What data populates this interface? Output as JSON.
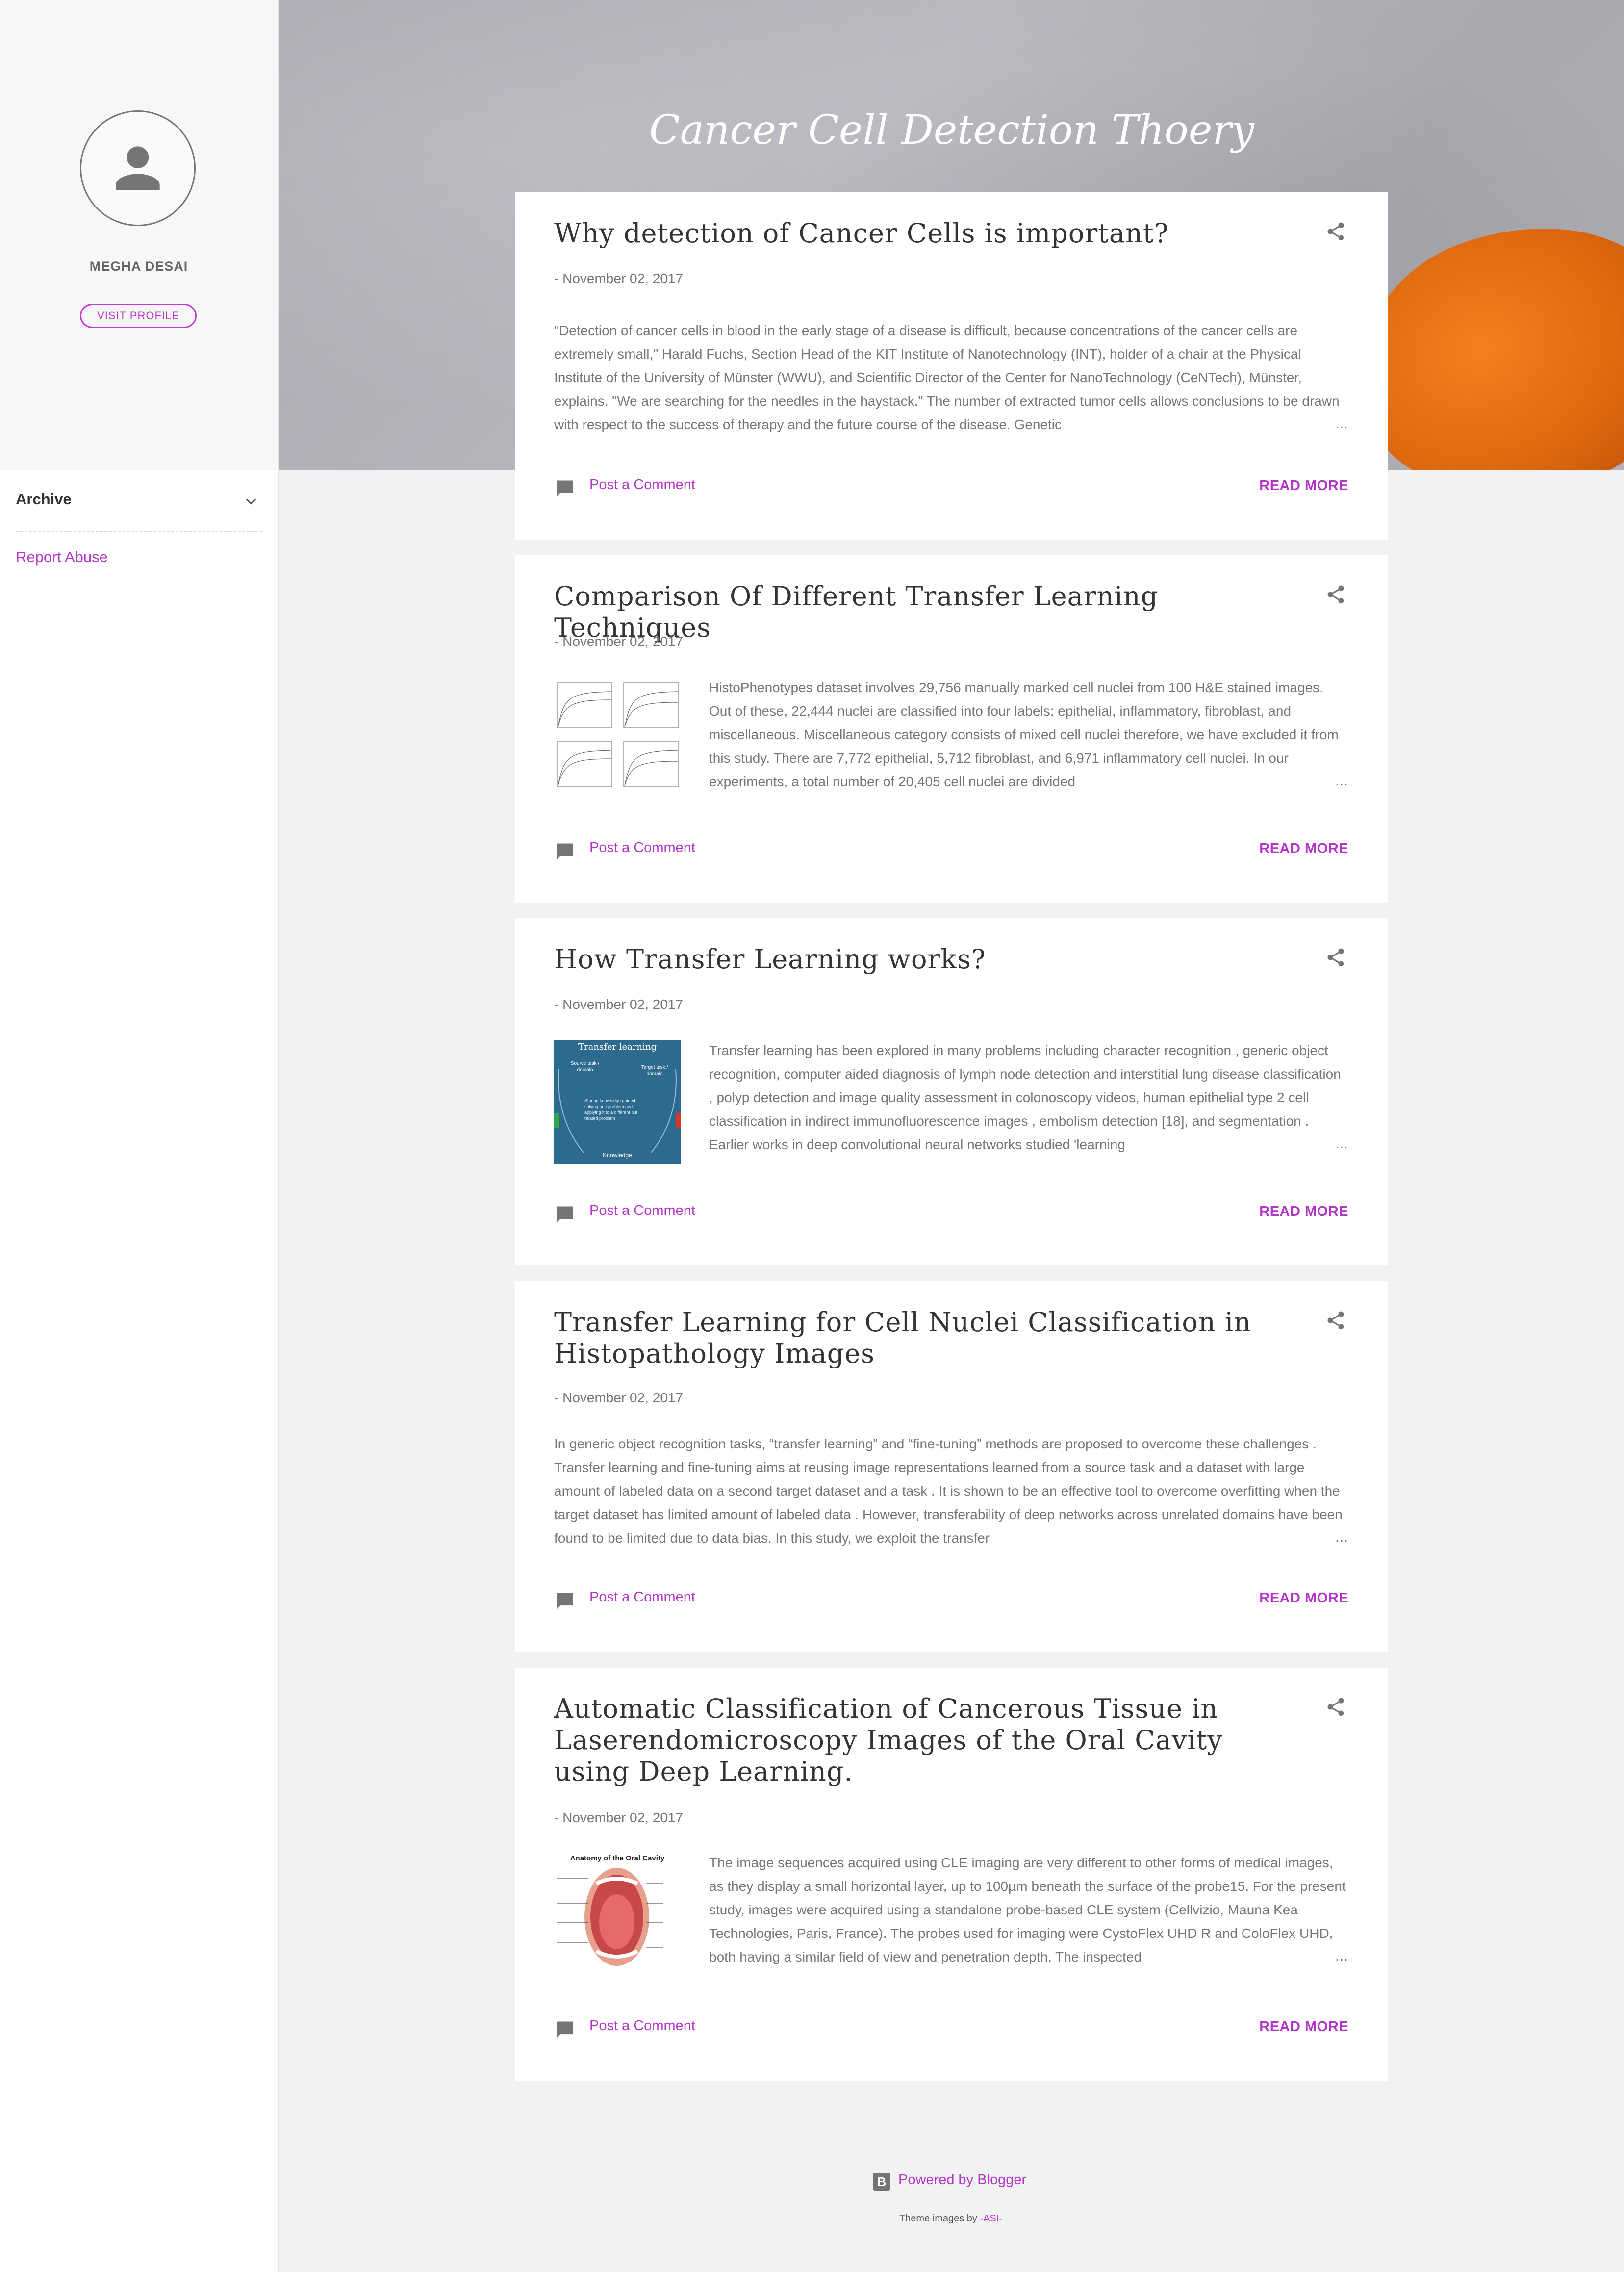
{
  "sidebar": {
    "profile_name": "MEGHA DESAI",
    "visit_profile": "VISIT PROFILE",
    "archive_label": "Archive",
    "report_abuse": "Report Abuse"
  },
  "header": {
    "title": "Cancer Cell Detection Thoery",
    "search_icon": "search-icon"
  },
  "colors": {
    "accent": "#b335c8",
    "text": "#757575",
    "title": "#333333"
  },
  "posts": [
    {
      "title": "Why detection of Cancer Cells is important?",
      "date": "- November 02, 2017",
      "snippet": "\"Detection of cancer cells in blood in the early stage of a disease is difficult, because concentrations of the cancer cells are extremely small,\" Harald Fuchs, Section Head of the KIT Institute of Nanotechnology (INT), holder of a chair at the Physical Institute of the University of Münster (WWU), and Scientific Director of the Center for NanoTechnology (CeNTech), Münster, explains. \"We are searching for the needles in the haystack.\" The number of extracted tumor cells allows conclusions to be drawn with respect to the success of therapy and the future course of the disease. Genetic",
      "ellipsis": "…",
      "comment": "Post a Comment",
      "read_more": "READ MORE"
    },
    {
      "title": "Comparison Of Different Transfer Learning Techniques",
      "date": "- November 02, 2017",
      "snippet": "HistoPhenotypes dataset involves 29,756 manually marked cell nuclei from 100 H&E stained images. Out of these, 22,444 nuclei are classified into four labels: epithelial, inflammatory, fibroblast, and miscellaneous. Miscellaneous category consists of mixed cell nuclei therefore, we have excluded it from this study. There are 7,772 epithelial, 5,712 fibroblast, and 6,971 inflammatory cell nuclei. In our experiments, a total number of 20,405 cell nuclei are divided",
      "ellipsis": "…",
      "comment": "Post a Comment",
      "read_more": "READ MORE"
    },
    {
      "title": "How Transfer Learning works?",
      "date": "- November 02, 2017",
      "snippet": "Transfer learning has been explored in many problems including character recognition , generic object recognition, computer aided diagnosis of lymph node detection and interstitial lung disease classification , polyp detection and image quality assessment in colonoscopy videos, human epithelial type 2 cell classification in indirect immunofluorescence images , embolism detection [18], and segmentation . Earlier works in deep convolutional neural networks studied 'learning",
      "ellipsis": "…",
      "comment": "Post a Comment",
      "read_more": "READ MORE",
      "thumb": {
        "title": "Transfer learning",
        "source": "Source task / domain",
        "target": "Target task / domain",
        "body": "Storing knowledge gained solving one problem and applying it to a different but related problem",
        "knowledge": "Knowledge"
      }
    },
    {
      "title": "Transfer Learning for Cell Nuclei Classification in Histopathology Images",
      "date": "- November 02, 2017",
      "snippet": "In generic object recognition tasks, “transfer learning” and “fine-tuning” methods are proposed to overcome these challenges . Transfer learning and fine-tuning aims at reusing image representations learned from a source task and a dataset with large amount of labeled data on a second target dataset and a task . It is shown to be an effective tool to overcome overfitting when the target dataset has limited amount of labeled data . However, transferability of deep networks across unrelated domains have been found to be limited due to data bias. In this study, we exploit the transfer",
      "ellipsis": "…",
      "comment": "Post a Comment",
      "read_more": "READ MORE"
    },
    {
      "title": "Automatic Classification of Cancerous Tissue in Laserendomicroscopy Images of the Oral Cavity using Deep Learning.",
      "date": "- November 02, 2017",
      "snippet": "The image sequences acquired using CLE imaging are very different to other forms of medical images, as they display a small horizontal layer, up to 100µm beneath the surface of the probe15. For the present study, images were acquired using a standalone probe-based CLE system (Cellvizio, Mauna Kea Technologies, Paris, France). The probes used for imaging were CystoFlex UHD R and ColoFlex UHD, both having a similar field of view and penetration depth. The inspected",
      "ellipsis": "…",
      "comment": "Post a Comment",
      "read_more": "READ MORE",
      "thumb": {
        "title": "Anatomy of the Oral Cavity"
      }
    }
  ],
  "footer": {
    "powered": "Powered by Blogger",
    "blogger_glyph": "B",
    "theme_prefix": "Theme images by",
    "theme_author": "-ASI-"
  }
}
